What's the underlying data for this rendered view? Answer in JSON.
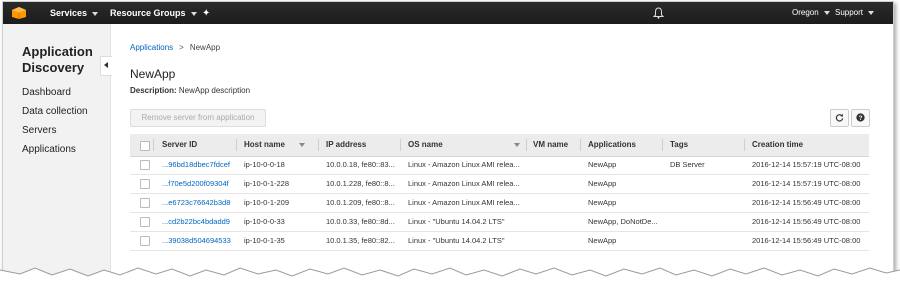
{
  "topbar": {
    "services_label": "Services",
    "resource_groups_label": "Resource Groups",
    "region_label": "Oregon",
    "support_label": "Support",
    "logo_icon": "aws-cube-icon",
    "pin_icon": "pin-icon",
    "bell_icon": "bell-icon"
  },
  "sidebar": {
    "title_line1": "Application",
    "title_line2": "Discovery",
    "items": [
      {
        "label": "Dashboard"
      },
      {
        "label": "Data collection"
      },
      {
        "label": "Servers"
      },
      {
        "label": "Applications"
      }
    ]
  },
  "breadcrumb": {
    "parent": "Applications",
    "sep": ">",
    "current": "NewApp"
  },
  "page": {
    "title": "NewApp",
    "description_label": "Description:",
    "description_value": "NewApp description"
  },
  "toolbar": {
    "remove_label": "Remove server from application"
  },
  "table": {
    "headers": {
      "server_id": "Server ID",
      "host_name": "Host name",
      "ip_address": "IP address",
      "os_name": "OS name",
      "vm_name": "VM name",
      "applications": "Applications",
      "tags": "Tags",
      "creation_time": "Creation time"
    },
    "rows": [
      {
        "server_id": "...96bd18dbec7fdcef",
        "host": "ip-10-0-0-18",
        "ip": "10.0.0.18, fe80::83...",
        "os": "Linux - Amazon Linux AMI relea...",
        "vm": "",
        "apps": "NewApp",
        "tags": "DB Server",
        "created": "2016-12-14 15:57:19 UTC-08:00"
      },
      {
        "server_id": "...f70e5d200f09304f",
        "host": "ip-10-0-1-228",
        "ip": "10.0.1.228, fe80::8...",
        "os": "Linux - Amazon Linux AMI relea...",
        "vm": "",
        "apps": "NewApp",
        "tags": "",
        "created": "2016-12-14 15:57:19 UTC-08:00"
      },
      {
        "server_id": "...e6723c76642b3d8",
        "host": "ip-10-0-1-209",
        "ip": "10.0.1.209, fe80::8...",
        "os": "Linux - Amazon Linux AMI relea...",
        "vm": "",
        "apps": "NewApp",
        "tags": "",
        "created": "2016-12-14 15:56:49 UTC-08:00"
      },
      {
        "server_id": "...cd2b22bc4bdadd9",
        "host": "ip-10-0-0-33",
        "ip": "10.0.0.33, fe80::8d...",
        "os": "Linux - \"Ubuntu 14.04.2 LTS\"",
        "vm": "",
        "apps": "NewApp, DoNotDe...",
        "tags": "",
        "created": "2016-12-14 15:56:49 UTC-08:00"
      },
      {
        "server_id": "...39038d504694533",
        "host": "ip-10-0-1-35",
        "ip": "10.0.1.35, fe80::82...",
        "os": "Linux - \"Ubuntu 14.04.2 LTS\"",
        "vm": "",
        "apps": "NewApp",
        "tags": "",
        "created": "2016-12-14 15:56:49 UTC-08:00"
      }
    ]
  },
  "colors": {
    "topbar": "#232f3e",
    "link": "#0066c0",
    "aws_orange": "#f90"
  }
}
